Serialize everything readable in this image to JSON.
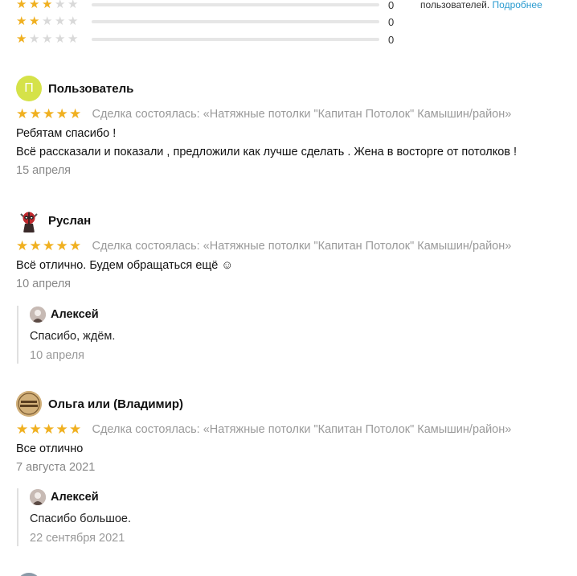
{
  "top_note": {
    "text": "пользователей.",
    "link": "Подробнее"
  },
  "distribution": [
    {
      "stars": 3,
      "count": "0",
      "fill": 0
    },
    {
      "stars": 2,
      "count": "0",
      "fill": 0
    },
    {
      "stars": 1,
      "count": "0",
      "fill": 0
    }
  ],
  "reviews": [
    {
      "author": "Пользователь",
      "avatar_letter": "П",
      "rating": 5,
      "deal": "Сделка состоялась: «Натяжные потолки \"Капитан Потолок\" Камышин/район»",
      "lines": [
        "Ребятам спасибо !",
        "Всё рассказали и показали , предложили как лучше сделать . Жена в восторге от потолков !"
      ],
      "date": "15 апреля"
    },
    {
      "author": "Руслан",
      "avatar_icon": "deadpool-avatar-icon",
      "rating": 5,
      "deal": "Сделка состоялась: «Натяжные потолки \"Капитан Потолок\" Камышин/район»",
      "lines": [
        "Всё отлично. Будем обращаться ещё ☺"
      ],
      "date": "10 апреля",
      "reply": {
        "author": "Алексей",
        "text": "Спасибо, ждём.",
        "date": "10 апреля"
      }
    },
    {
      "author": "Ольга или (Владимир)",
      "avatar_icon": "badge-avatar-icon",
      "rating": 5,
      "deal": "Сделка состоялась: «Натяжные потолки \"Капитан Потолок\" Камышин/район»",
      "lines": [
        "Все отлично"
      ],
      "date": "7 августа 2021",
      "reply": {
        "author": "Алексей",
        "text": "Спасибо большое.",
        "date": "22 сентября 2021"
      }
    }
  ],
  "colors": {
    "star_on": "#f0b020",
    "star_off": "#d9d9d9",
    "link": "#2a9bd0",
    "avatar_letter_bg": "#d5e249"
  }
}
